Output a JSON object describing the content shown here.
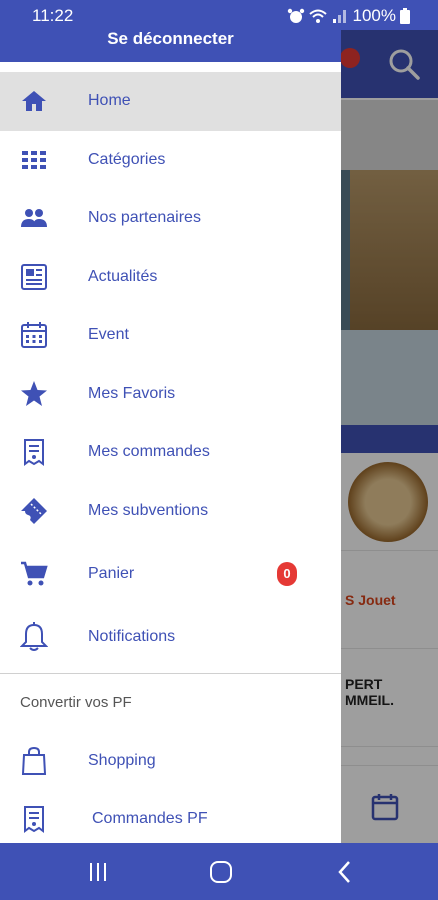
{
  "status_bar": {
    "time": "11:22",
    "battery": "100%"
  },
  "drawer": {
    "header_label": "Se déconnecter",
    "items": [
      {
        "label": "Home",
        "icon": "home-icon",
        "active": true
      },
      {
        "label": "Catégories",
        "icon": "grid-icon"
      },
      {
        "label": "Nos partenaires",
        "icon": "people-icon"
      },
      {
        "label": "Actualités",
        "icon": "newspaper-icon"
      },
      {
        "label": "Event",
        "icon": "calendar-icon"
      },
      {
        "label": "Mes Favoris",
        "icon": "star-icon"
      },
      {
        "label": "Mes commandes",
        "icon": "receipt-icon"
      },
      {
        "label": "Mes subventions",
        "icon": "ticket-icon"
      },
      {
        "label": "Panier",
        "icon": "cart-icon",
        "badge": "0"
      },
      {
        "label": "Notifications",
        "icon": "bell-icon"
      }
    ],
    "section_title": "Convertir vos PF",
    "pf_items": [
      {
        "label": "Shopping",
        "icon": "shopping-bag-icon"
      },
      {
        "label": "Commandes PF",
        "icon": "receipt-icon"
      }
    ]
  },
  "background": {
    "logo_text_1": "S Jouet",
    "logo_text_2": "PERT\nMMEIL."
  },
  "colors": {
    "primary": "#3f51b5",
    "badge": "#e53935",
    "active_bg": "#e0e0e0"
  }
}
